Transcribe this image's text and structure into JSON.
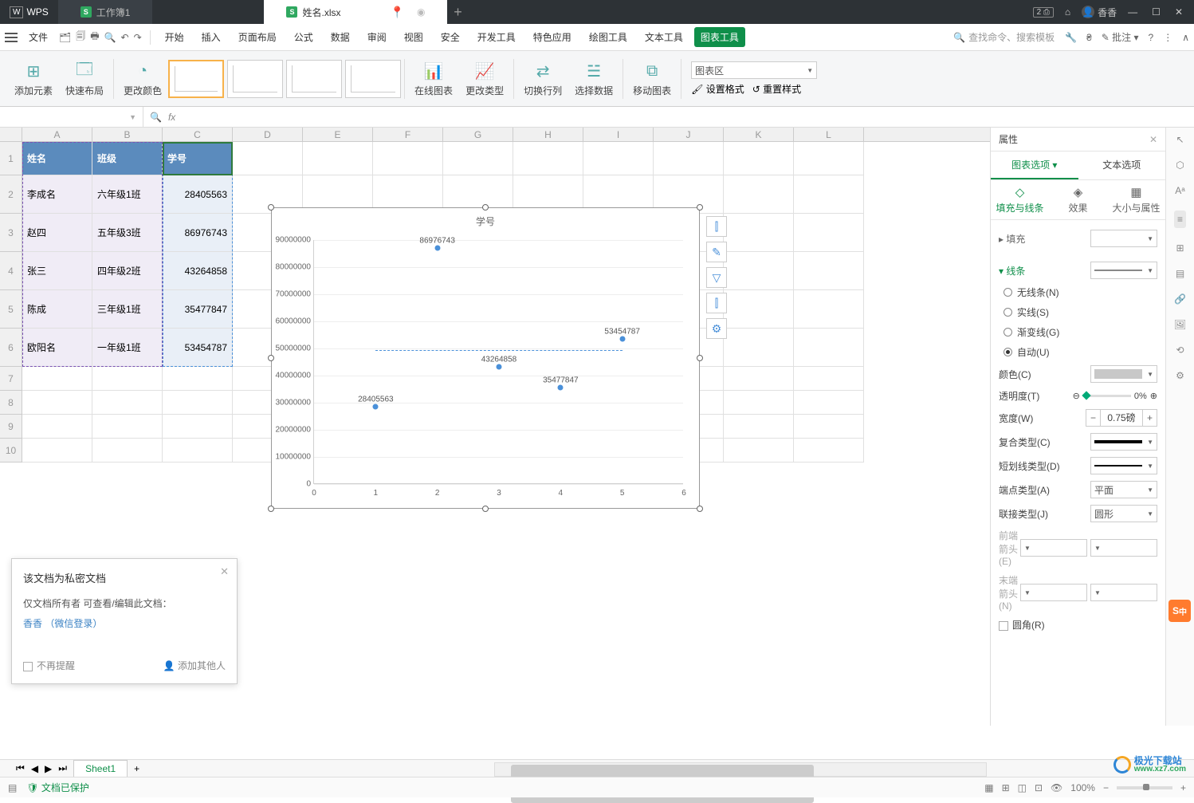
{
  "titlebar": {
    "app": "WPS",
    "tabs": [
      {
        "label": "工作簿1",
        "color": "#22a55a"
      },
      {
        "label": "姓名.xlsx",
        "color": "#22a55a",
        "active": true
      }
    ],
    "user": "香香"
  },
  "menubar": {
    "file": "文件",
    "items": [
      "开始",
      "插入",
      "页面布局",
      "公式",
      "数据",
      "审阅",
      "视图",
      "安全",
      "开发工具",
      "特色应用",
      "绘图工具",
      "文本工具",
      "图表工具"
    ],
    "search_placeholder": "查找命令、搜索模板",
    "batch": "批注"
  },
  "ribbon": {
    "add_element": "添加元素",
    "quick_layout": "快速布局",
    "change_color": "更改颜色",
    "online_chart": "在线图表",
    "change_type": "更改类型",
    "switch_rc": "切换行列",
    "select_data": "选择数据",
    "move_chart": "移动图表",
    "set_format": "设置格式",
    "reset_style": "重置样式",
    "area_combo": "图表区"
  },
  "table": {
    "headers": {
      "a": "姓名",
      "b": "班级",
      "c": "学号"
    },
    "rows": [
      {
        "a": "李成名",
        "b": "六年级1班",
        "c": "28405563"
      },
      {
        "a": "赵四",
        "b": "五年级3班",
        "c": "86976743"
      },
      {
        "a": "张三",
        "b": "四年级2班",
        "c": "43264858"
      },
      {
        "a": "陈成",
        "b": "三年级1班",
        "c": "35477847"
      },
      {
        "a": "欧阳名",
        "b": "一年级1班",
        "c": "53454787"
      }
    ],
    "col_letters": [
      "A",
      "B",
      "C",
      "D",
      "E",
      "F",
      "G",
      "H",
      "I",
      "J",
      "K",
      "L"
    ]
  },
  "chart_data": {
    "type": "scatter",
    "title": "学号",
    "xlabel": "",
    "ylabel": "",
    "xlim": [
      0,
      6
    ],
    "ylim": [
      0,
      90000000
    ],
    "x": [
      1,
      2,
      3,
      4,
      5
    ],
    "y": [
      28405563,
      86976743,
      43264858,
      35477847,
      53454787
    ],
    "labels": [
      "28405563",
      "86976743",
      "43264858",
      "35477847",
      "53454787"
    ],
    "yticks": [
      0,
      10000000,
      20000000,
      30000000,
      40000000,
      50000000,
      60000000,
      70000000,
      80000000,
      90000000
    ],
    "xticks": [
      0,
      1,
      2,
      3,
      4,
      5,
      6
    ],
    "trendline": {
      "x0": 1,
      "x1": 5,
      "y": 49515959
    }
  },
  "chart_side": [
    "⫿",
    "✎",
    "▽",
    "⫿",
    "⚙"
  ],
  "panel": {
    "title": "属性",
    "tab1": "图表选项",
    "tab2": "文本选项",
    "sub": {
      "fill": "填充与线条",
      "effect": "效果",
      "size": "大小与属性"
    },
    "fill_section": "填充",
    "line_section": "线条",
    "radios": {
      "none": "无线条(N)",
      "solid": "实线(S)",
      "grad": "渐变线(G)",
      "auto": "自动(U)"
    },
    "color": "颜色(C)",
    "opacity": "透明度(T)",
    "opacity_val": "0%",
    "width": "宽度(W)",
    "width_val": "0.75磅",
    "compound": "复合类型(C)",
    "dash": "短划线类型(D)",
    "cap": "端点类型(A)",
    "cap_val": "平面",
    "join": "联接类型(J)",
    "join_val": "圆形",
    "arrow_start": "前端箭头(E)",
    "arrow_end": "末端箭头(N)",
    "round": "圆角(R)"
  },
  "popup": {
    "title": "该文档为私密文档",
    "body": "仅文档所有者 可查看/编辑此文档：",
    "link": "香香 （微信登录）",
    "noremind": "不再提醒",
    "addother": "添加其他人"
  },
  "statusbar": {
    "protect": "文档已保护",
    "zoom": "100%",
    "sheet": "Sheet1"
  },
  "watermark": {
    "brand": "极光下载站",
    "url": "www.xz7.com"
  }
}
